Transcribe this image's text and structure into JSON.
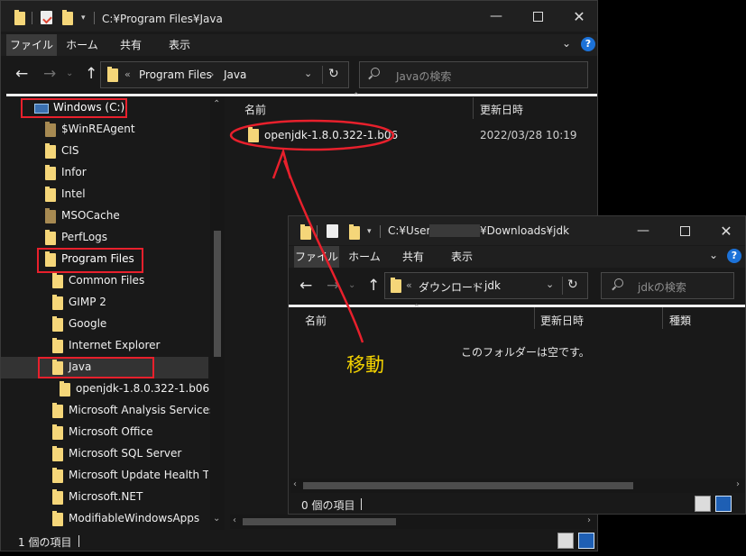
{
  "main_window": {
    "title": "C:¥Program Files¥Java",
    "ribbon_tabs": [
      "ファイル",
      "ホーム",
      "共有",
      "表示"
    ],
    "address": {
      "sep": "«",
      "crumbs": [
        "Program Files",
        "Java"
      ]
    },
    "search_placeholder": "Javaの検索",
    "tree": [
      {
        "label": "Windows (C:)",
        "icon": "drive-icon"
      },
      {
        "label": "$WinREAgent",
        "icon": "folder-dark"
      },
      {
        "label": "CIS",
        "icon": "folder"
      },
      {
        "label": "Infor",
        "icon": "folder"
      },
      {
        "label": "Intel",
        "icon": "folder"
      },
      {
        "label": "MSOCache",
        "icon": "folder-dark"
      },
      {
        "label": "PerfLogs",
        "icon": "folder"
      },
      {
        "label": "Program Files",
        "icon": "folder"
      },
      {
        "label": "Common Files",
        "icon": "folder"
      },
      {
        "label": "GIMP 2",
        "icon": "folder"
      },
      {
        "label": "Google",
        "icon": "folder"
      },
      {
        "label": "Internet Explorer",
        "icon": "folder"
      },
      {
        "label": "Java",
        "icon": "folder"
      },
      {
        "label": "openjdk-1.8.0.322-1.b06",
        "icon": "folder"
      },
      {
        "label": "Microsoft Analysis Services",
        "icon": "folder"
      },
      {
        "label": "Microsoft Office",
        "icon": "folder"
      },
      {
        "label": "Microsoft SQL Server",
        "icon": "folder"
      },
      {
        "label": "Microsoft Update Health Tools",
        "icon": "folder"
      },
      {
        "label": "Microsoft.NET",
        "icon": "folder"
      },
      {
        "label": "ModifiableWindowsApps",
        "icon": "folder"
      }
    ],
    "columns": {
      "name": "名前",
      "date": "更新日時"
    },
    "files": [
      {
        "name": "openjdk-1.8.0.322-1.b06",
        "date": "2022/03/28 10:19"
      }
    ],
    "status": "1 個の項目"
  },
  "second_window": {
    "title_prefix": "C:¥Users",
    "title_suffix": "¥Downloads¥jdk",
    "ribbon_tabs": [
      "ファイル",
      "ホーム",
      "共有",
      "表示"
    ],
    "address": {
      "sep": "«",
      "crumbs": [
        "ダウンロード",
        "jdk"
      ]
    },
    "search_placeholder": "jdkの検索",
    "columns": {
      "name": "名前",
      "date": "更新日時",
      "type": "種類"
    },
    "empty_message": "このフォルダーは空です。",
    "status": "0 個の項目"
  },
  "annotation": {
    "label": "移動",
    "color": "#e8202c",
    "text_color": "#f5d400"
  }
}
